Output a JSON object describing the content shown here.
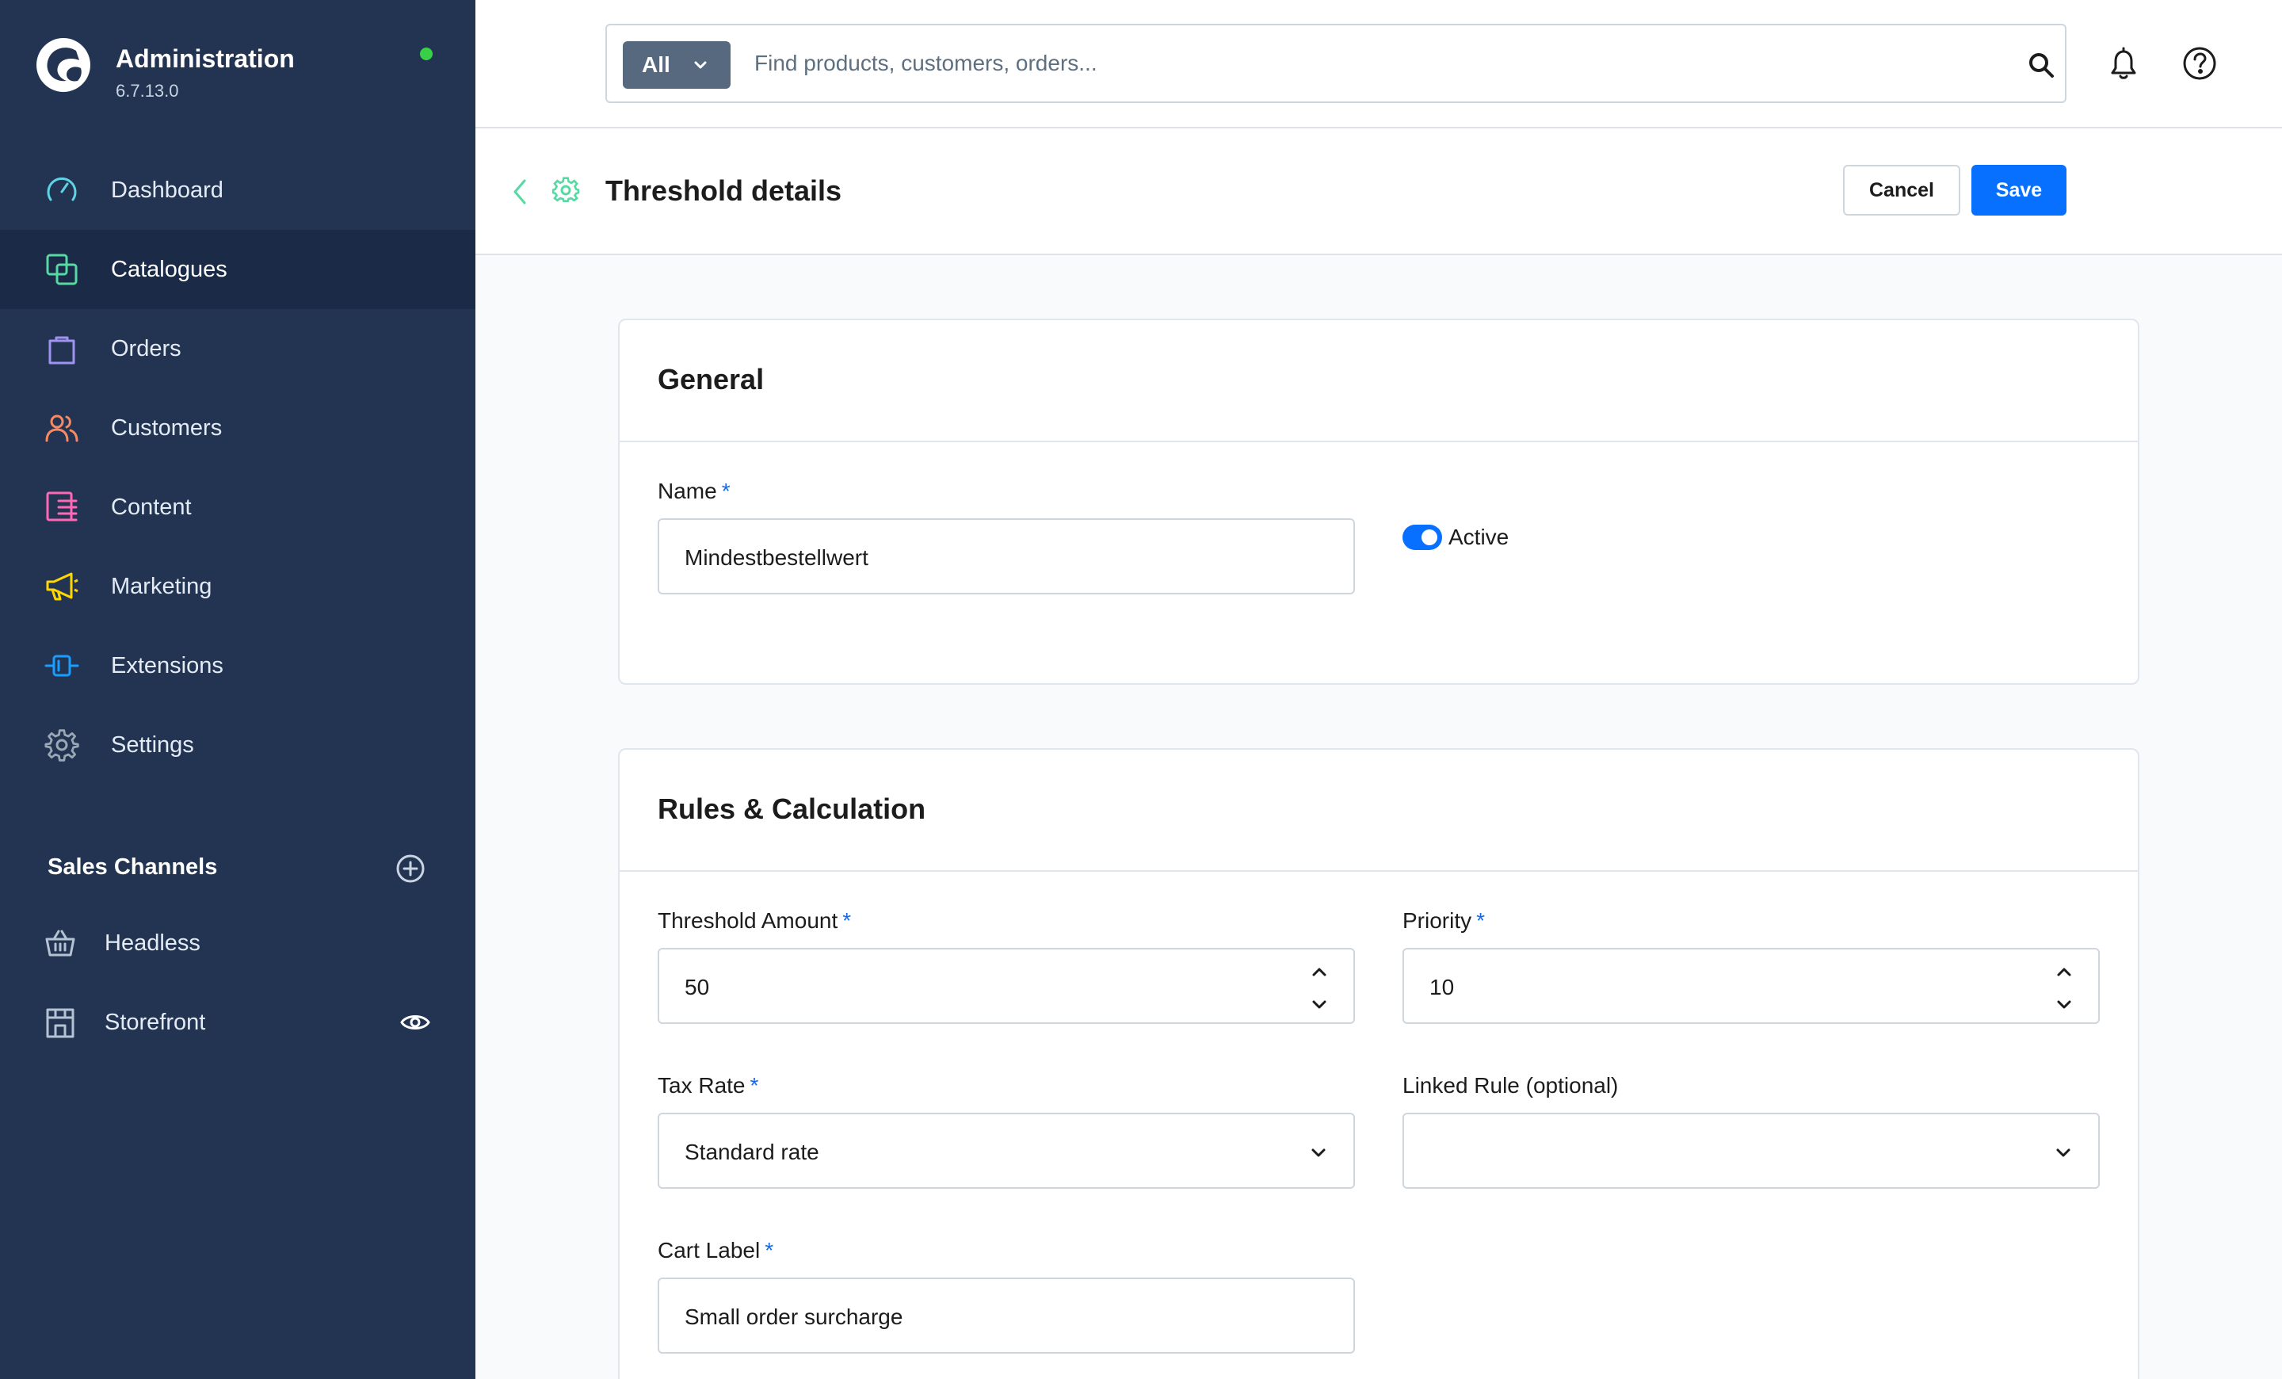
{
  "brand": {
    "title": "Administration",
    "version": "6.7.13.0",
    "status_color": "#37d046"
  },
  "sidebar": {
    "items": [
      {
        "label": "Dashboard",
        "icon": "gauge-icon",
        "color": "#5fd3e6",
        "active": false
      },
      {
        "label": "Catalogues",
        "icon": "catalogue-icon",
        "color": "#57d9a3",
        "active": true
      },
      {
        "label": "Orders",
        "icon": "shopping-bag-icon",
        "color": "#a092f0",
        "active": false
      },
      {
        "label": "Customers",
        "icon": "users-icon",
        "color": "#f88962",
        "active": false
      },
      {
        "label": "Content",
        "icon": "content-icon",
        "color": "#ff68b4",
        "active": false
      },
      {
        "label": "Marketing",
        "icon": "megaphone-icon",
        "color": "#ffd700",
        "active": false
      },
      {
        "label": "Extensions",
        "icon": "plug-icon",
        "color": "#189eff",
        "active": false
      },
      {
        "label": "Settings",
        "icon": "gear-icon",
        "color": "#9aa8b5",
        "active": false
      }
    ],
    "sales_channels": {
      "title": "Sales Channels",
      "items": [
        {
          "label": "Headless",
          "icon": "basket-icon"
        },
        {
          "label": "Storefront",
          "icon": "storefront-icon"
        }
      ]
    }
  },
  "search": {
    "type_label": "All",
    "placeholder": "Find products, customers, orders..."
  },
  "smartbar": {
    "title": "Threshold details",
    "cancel_label": "Cancel",
    "save_label": "Save"
  },
  "general": {
    "title": "General",
    "name_label": "Name",
    "required_mark": "*",
    "name_value": "Mindestbestellwert",
    "active_label": "Active",
    "active": true
  },
  "rules": {
    "title": "Rules & Calculation",
    "threshold_label": "Threshold Amount",
    "threshold_value": "50",
    "priority_label": "Priority",
    "priority_value": "10",
    "tax_label": "Tax Rate",
    "tax_value": "Standard rate",
    "linked_label": "Linked Rule (optional)",
    "linked_value": "",
    "cart_label": "Cart Label",
    "cart_value": "Small order surcharge"
  },
  "colors": {
    "sidebar_bg": "#233452",
    "sidebar_active_bg": "#1a2a47",
    "primary": "#0870ff",
    "accent_green": "#57d9a3"
  }
}
